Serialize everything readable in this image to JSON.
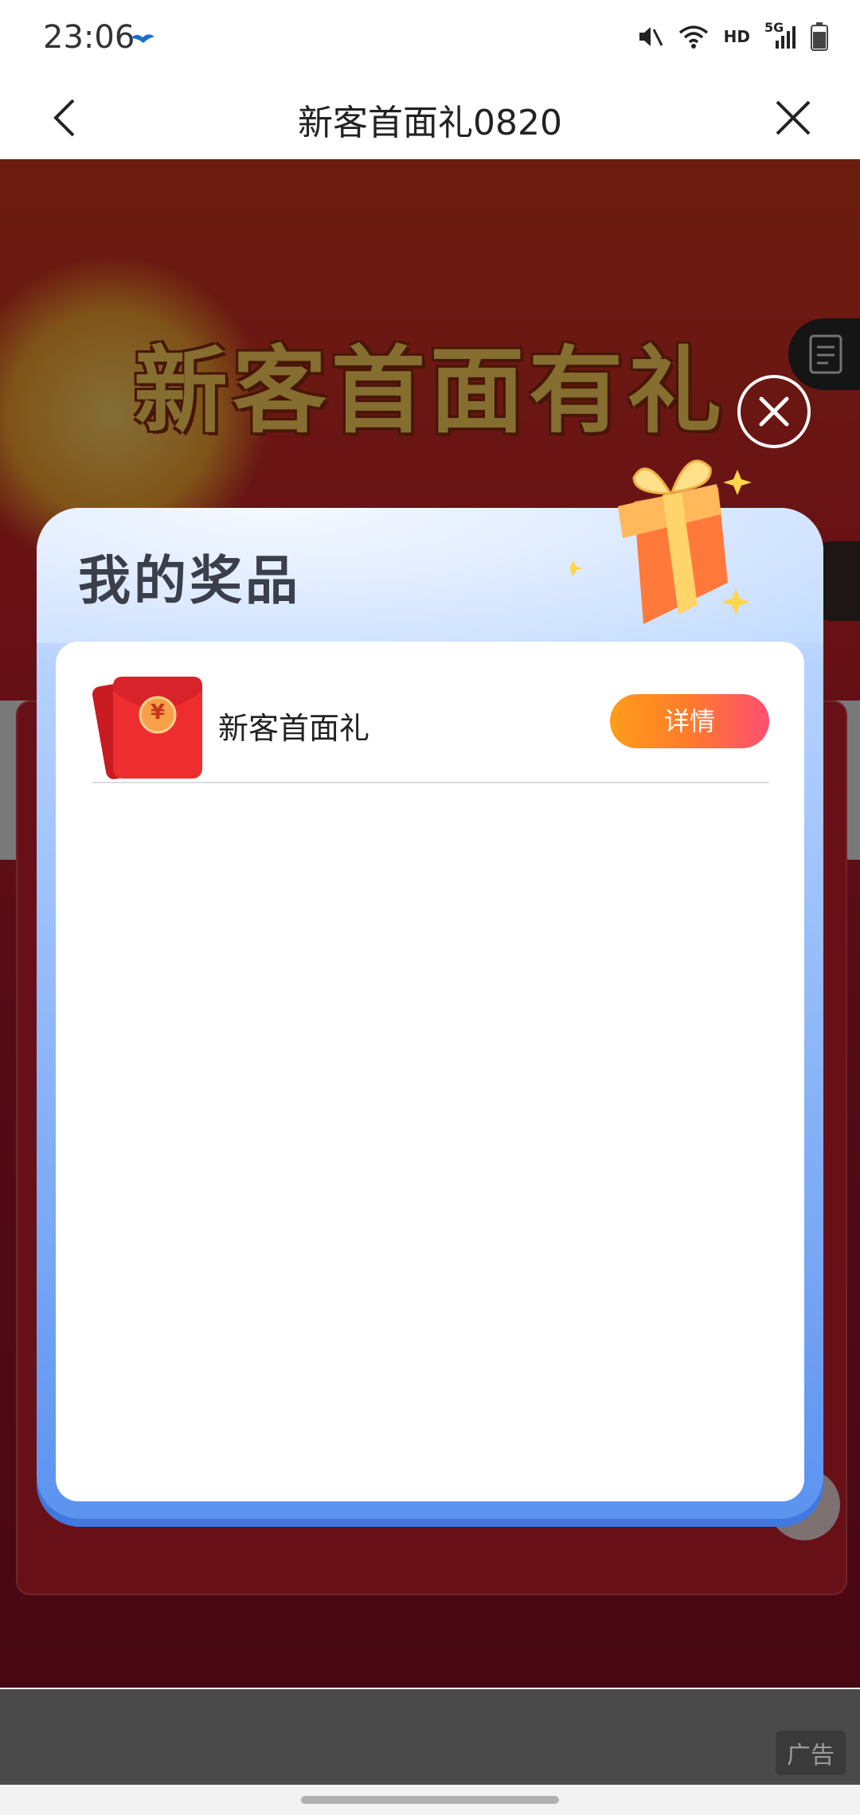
{
  "status_bar": {
    "time": "23:06",
    "network_label": "HD",
    "signal_label": "5G"
  },
  "nav": {
    "title": "新客首面礼0820"
  },
  "page": {
    "banner_title": "新客首面有礼"
  },
  "popup": {
    "title": "我的奖品",
    "prizes": [
      {
        "name": "新客首面礼",
        "action_label": "详情",
        "currency_symbol": "¥"
      }
    ]
  },
  "ad": {
    "label": "广告"
  },
  "colors": {
    "detail_button_start": "#ff9d1a",
    "detail_button_end": "#ff4f73",
    "popup_accent": "#5b93ef",
    "red_packet": "#e8262d"
  }
}
